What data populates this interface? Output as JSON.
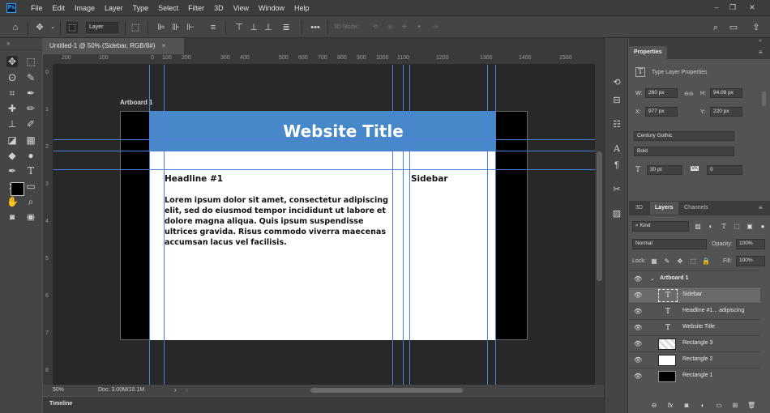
{
  "app": {
    "logo": "Ps"
  },
  "menu": [
    "File",
    "Edit",
    "Image",
    "Layer",
    "Type",
    "Select",
    "Filter",
    "3D",
    "View",
    "Window",
    "Help"
  ],
  "options_bar": {
    "auto_select_target": "Layer",
    "mode_3d_label": "3D Mode:"
  },
  "document": {
    "tab_title": "Untitled-1 @ 50% (Sidebar, RGB/8#)",
    "close_glyph": "×"
  },
  "ruler": {
    "h_labels": [
      "200",
      "100",
      "0",
      "100",
      "200",
      "300",
      "400",
      "500",
      "600",
      "700",
      "800",
      "900",
      "1000",
      "1100",
      "1200",
      "1300",
      "1400",
      "1500"
    ],
    "v_labels": [
      "0",
      "1",
      "2",
      "3",
      "4",
      "5",
      "6",
      "7",
      "8"
    ]
  },
  "artboard": {
    "label": "Artboard 1",
    "header_title": "Website Title",
    "headline": "Headline #1",
    "body": "Lorem ipsum dolor sit amet, consectetur adipiscing elit, sed do eiusmod tempor incididunt ut labore et dolore magna aliqua. Quis ipsum suspendisse ultrices gravida. Risus commodo viverra maecenas accumsan lacus vel facilisis.",
    "sidebar_heading": "Sidebar",
    "header_color": "#4788c8"
  },
  "status": {
    "zoom": "50%",
    "doc": "Doc: 3.00M/10.1M"
  },
  "timeline": {
    "label": "Timeline"
  },
  "properties": {
    "tab": "Properties",
    "subtitle": "Type Layer Properties",
    "w_label": "W:",
    "w": "260 px",
    "h_label": "H:",
    "h": "94.08 px",
    "x_label": "X:",
    "x": "977 px",
    "y_label": "Y:",
    "y": "220 px",
    "font_family": "Century Gothic",
    "font_style": "Bold",
    "font_size": "30 pt",
    "tracking": "0",
    "tracking_label": "VA"
  },
  "layers_panel": {
    "tabs": [
      "3D",
      "Layers",
      "Channels"
    ],
    "kind": "Kind",
    "blend_mode": "Normal",
    "opacity_label": "Opacity:",
    "opacity": "100%",
    "lock_label": "Lock:",
    "fill_label": "Fill:",
    "fill": "100%",
    "layers": [
      {
        "name": "Artboard 1",
        "type": "artboard"
      },
      {
        "name": "Sidebar",
        "type": "text",
        "selected": true
      },
      {
        "name": "Headline #1... adipiscing",
        "type": "text"
      },
      {
        "name": "Website Title",
        "type": "text"
      },
      {
        "name": "Rectangle 3",
        "type": "shape"
      },
      {
        "name": "Rectangle 2",
        "type": "shape"
      },
      {
        "name": "Rectangle 1",
        "type": "shape"
      }
    ]
  }
}
